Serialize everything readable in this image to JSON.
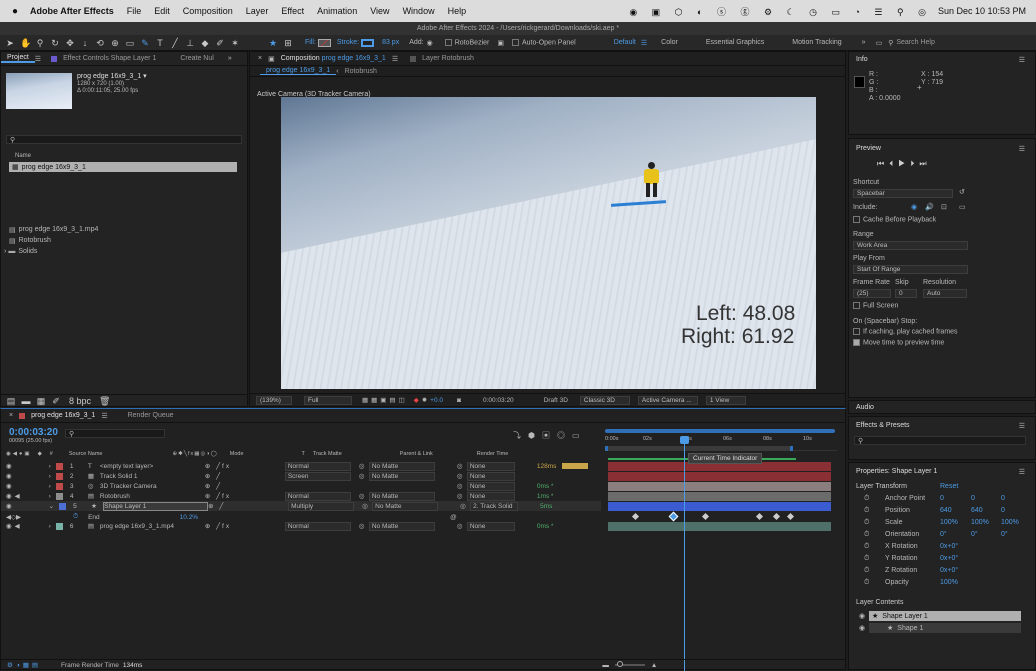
{
  "menubar": {
    "app": "Adobe After Effects",
    "items": [
      "File",
      "Edit",
      "Composition",
      "Layer",
      "Effect",
      "Animation",
      "View",
      "Window",
      "Help"
    ],
    "clock": "Sun Dec 10  10:53 PM"
  },
  "titlebar": {
    "text": "Adobe After Effects 2024 - /Users/rickgerard/Downloads/ski.aep *"
  },
  "toolbar": {
    "fill_label": "Fill:",
    "stroke_label": "Stroke:",
    "stroke_px": "83 px",
    "add_label": "Add:",
    "rotobezier": "RotoBezier",
    "auto_open": "Auto-Open Panel",
    "workspaces": [
      "Default",
      "Color",
      "Essential Graphics",
      "Motion Tracking"
    ],
    "search_placeholder": "Search Help"
  },
  "project": {
    "tab": "Project",
    "tab2": "Effect Controls Shape Layer 1",
    "create_null": "Create Nul",
    "comp_name": "prog edge 16x9_3_1 ▾",
    "comp_meta1": "1280 x 720 (1.00)",
    "comp_meta2": "Δ 0:00:11:05, 25.00 fps",
    "col_name": "Name",
    "items": [
      "prog edge 16x9_3_1",
      "prog edge 16x9_3_1.mp4",
      "Rotobrush",
      "Solids"
    ],
    "bpc": "8 bpc"
  },
  "comp": {
    "tab_prefix": "Composition",
    "tab_name": "prog edge 16x9_3_1",
    "tab_layer": "Layer Rotobrush",
    "crumb1": "prog edge 16x9_3_1",
    "crumb2": "Rotobrush",
    "camera_label": "Active Camera (3D Tracker Camera)",
    "overlay_left": "Left: 48.08",
    "overlay_right": "Right: 61.92",
    "zoom": "(139%)",
    "quality": "Full",
    "exposure": "+0.0",
    "timecode": "0:00:03:20",
    "draft": "Draft 3D",
    "renderer": "Classic 3D",
    "view_cam": "Active Camera ...",
    "views": "1 View"
  },
  "info": {
    "title": "Info",
    "r": "R :",
    "g": "G :",
    "b": "B :",
    "a": "A : 0.0000",
    "x": "X : 154",
    "y": "Y : 719"
  },
  "preview": {
    "title": "Preview",
    "shortcut_label": "Shortcut",
    "shortcut": "Spacebar",
    "include_label": "Include:",
    "cache": "Cache Before Playback",
    "range_label": "Range",
    "range": "Work Area",
    "playfrom_label": "Play From",
    "playfrom": "Start Of Range",
    "fr_label": "Frame Rate",
    "skip_label": "Skip",
    "res_label": "Resolution",
    "fr": "(25)",
    "skip": "0",
    "res": "Auto",
    "fullscreen": "Full Screen",
    "stop_label": "On (Spacebar) Stop:",
    "stop1": "If caching, play cached frames",
    "stop2": "Move time to preview time"
  },
  "audio": {
    "title": "Audio"
  },
  "effects": {
    "title": "Effects & Presets"
  },
  "properties": {
    "title": "Properties: Shape Layer 1",
    "section": "Layer Transform",
    "reset": "Reset",
    "rows": [
      {
        "label": "Anchor Point",
        "v1": "0",
        "v2": "0",
        "v3": "0"
      },
      {
        "label": "Position",
        "v1": "640",
        "v2": "640",
        "v3": "0"
      },
      {
        "label": "Scale",
        "v1": "100%",
        "v2": "100%",
        "v3": "100%"
      },
      {
        "label": "Orientation",
        "v1": "0°",
        "v2": "0°",
        "v3": "0°"
      },
      {
        "label": "X Rotation",
        "v1": "0x+0°",
        "v2": "",
        "v3": ""
      },
      {
        "label": "Y Rotation",
        "v1": "0x+0°",
        "v2": "",
        "v3": ""
      },
      {
        "label": "Z Rotation",
        "v1": "0x+0°",
        "v2": "",
        "v3": ""
      },
      {
        "label": "Opacity",
        "v1": "100%",
        "v2": "",
        "v3": ""
      }
    ],
    "contents_title": "Layer Contents",
    "content1": "Shape Layer 1",
    "content2": "Shape 1"
  },
  "timeline": {
    "tab": "prog edge 16x9_3_1",
    "tab2": "Render Queue",
    "timecode": "0:00:03:20",
    "frames": "00095 (25.00 fps)",
    "cols": {
      "source": "Source Name",
      "mode": "Mode",
      "t": "T",
      "matte": "Track Matte",
      "parent": "Parent & Link",
      "render": "Render Time"
    },
    "layers": [
      {
        "num": "1",
        "color": "#c04a4a",
        "name": "<empty text layer>",
        "mode": "Normal",
        "matte": "No Matte",
        "parent": "None",
        "time": "128ms"
      },
      {
        "num": "2",
        "color": "#c04a4a",
        "name": "Track Solid 1",
        "mode": "Screen",
        "matte": "No Matte",
        "parent": "None",
        "time": ""
      },
      {
        "num": "3",
        "color": "#c04a4a",
        "name": "3D Tracker Camera",
        "mode": "",
        "matte": "",
        "parent": "None",
        "time": "0ms *"
      },
      {
        "num": "4",
        "color": "#8d8d8d",
        "name": "Rotobrush",
        "mode": "Normal",
        "matte": "No Matte",
        "parent": "None",
        "time": "1ms *"
      },
      {
        "num": "5",
        "color": "#4c6fd6",
        "name": "Shape Layer 1",
        "mode": "Multiply",
        "matte": "No Matte",
        "parent": "2. Track Solid",
        "time": "5ms"
      },
      {
        "num": "6",
        "color": "#77b3a6",
        "name": "prog edge 16x9_3_1.mp4",
        "mode": "Normal",
        "matte": "No Matte",
        "parent": "None",
        "time": "0ms *"
      }
    ],
    "prop_end": "End",
    "prop_end_val": "10.2%",
    "ruler": [
      "0:00s",
      "02s",
      "04s",
      "06s",
      "08s",
      "10s"
    ],
    "tooltip": "Current Time Indicator",
    "frame_render": "Frame Render Time",
    "frame_render_val": "134ms"
  }
}
